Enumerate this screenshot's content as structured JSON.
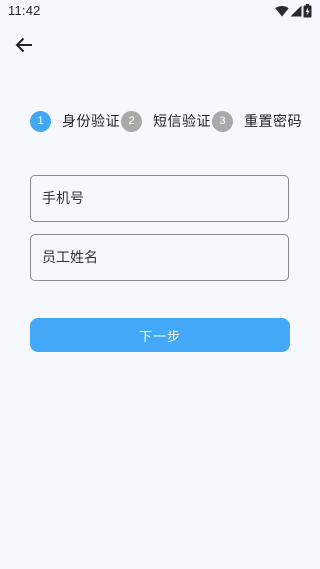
{
  "status_bar": {
    "time": "11:42",
    "icons": [
      "wifi-icon",
      "cellular-signal-icon",
      "battery-charging-icon"
    ]
  },
  "nav": {
    "back_icon": "arrow-left-icon"
  },
  "steps": [
    {
      "number": "1",
      "label": "身份验证",
      "state": "active"
    },
    {
      "number": "2",
      "label": "短信验证",
      "state": "inactive"
    },
    {
      "number": "3",
      "label": "重置密码",
      "state": "inactive"
    }
  ],
  "form": {
    "phone_placeholder": "手机号",
    "phone_value": "",
    "name_placeholder": "员工姓名",
    "name_value": ""
  },
  "actions": {
    "next_label": "下一步"
  },
  "colors": {
    "background": "#f7f8fd",
    "accent": "#43a8f7",
    "step_active": "#3fa9f5",
    "step_inactive": "#a9a9a9",
    "field_border": "#8b8b8b"
  }
}
